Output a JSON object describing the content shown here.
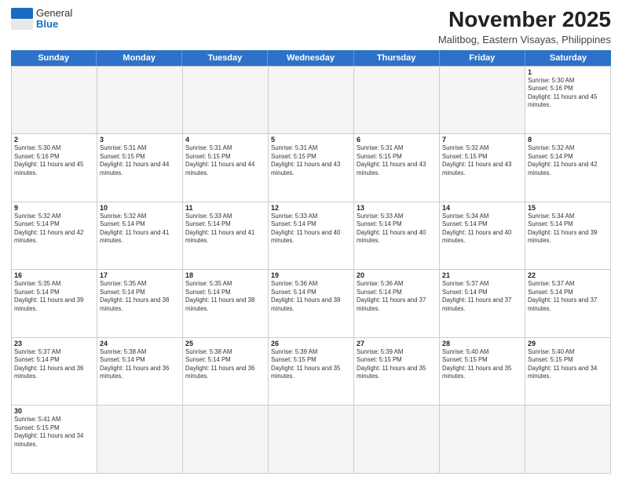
{
  "logo": {
    "general": "General",
    "blue": "Blue"
  },
  "header": {
    "month_year": "November 2025",
    "location": "Malitbog, Eastern Visayas, Philippines"
  },
  "weekdays": [
    "Sunday",
    "Monday",
    "Tuesday",
    "Wednesday",
    "Thursday",
    "Friday",
    "Saturday"
  ],
  "weeks": [
    [
      {
        "day": "",
        "empty": true
      },
      {
        "day": "",
        "empty": true
      },
      {
        "day": "",
        "empty": true
      },
      {
        "day": "",
        "empty": true
      },
      {
        "day": "",
        "empty": true
      },
      {
        "day": "",
        "empty": true
      },
      {
        "day": "1",
        "sunrise": "5:30 AM",
        "sunset": "5:16 PM",
        "daylight": "11 hours and 45 minutes."
      }
    ],
    [
      {
        "day": "2",
        "sunrise": "5:30 AM",
        "sunset": "5:16 PM",
        "daylight": "11 hours and 45 minutes."
      },
      {
        "day": "3",
        "sunrise": "5:31 AM",
        "sunset": "5:15 PM",
        "daylight": "11 hours and 44 minutes."
      },
      {
        "day": "4",
        "sunrise": "5:31 AM",
        "sunset": "5:15 PM",
        "daylight": "11 hours and 44 minutes."
      },
      {
        "day": "5",
        "sunrise": "5:31 AM",
        "sunset": "5:15 PM",
        "daylight": "11 hours and 43 minutes."
      },
      {
        "day": "6",
        "sunrise": "5:31 AM",
        "sunset": "5:15 PM",
        "daylight": "11 hours and 43 minutes."
      },
      {
        "day": "7",
        "sunrise": "5:32 AM",
        "sunset": "5:15 PM",
        "daylight": "11 hours and 43 minutes."
      },
      {
        "day": "8",
        "sunrise": "5:32 AM",
        "sunset": "5:14 PM",
        "daylight": "11 hours and 42 minutes."
      }
    ],
    [
      {
        "day": "9",
        "sunrise": "5:32 AM",
        "sunset": "5:14 PM",
        "daylight": "11 hours and 42 minutes."
      },
      {
        "day": "10",
        "sunrise": "5:32 AM",
        "sunset": "5:14 PM",
        "daylight": "11 hours and 41 minutes."
      },
      {
        "day": "11",
        "sunrise": "5:33 AM",
        "sunset": "5:14 PM",
        "daylight": "11 hours and 41 minutes."
      },
      {
        "day": "12",
        "sunrise": "5:33 AM",
        "sunset": "5:14 PM",
        "daylight": "11 hours and 40 minutes."
      },
      {
        "day": "13",
        "sunrise": "5:33 AM",
        "sunset": "5:14 PM",
        "daylight": "11 hours and 40 minutes."
      },
      {
        "day": "14",
        "sunrise": "5:34 AM",
        "sunset": "5:14 PM",
        "daylight": "11 hours and 40 minutes."
      },
      {
        "day": "15",
        "sunrise": "5:34 AM",
        "sunset": "5:14 PM",
        "daylight": "11 hours and 39 minutes."
      }
    ],
    [
      {
        "day": "16",
        "sunrise": "5:35 AM",
        "sunset": "5:14 PM",
        "daylight": "11 hours and 39 minutes."
      },
      {
        "day": "17",
        "sunrise": "5:35 AM",
        "sunset": "5:14 PM",
        "daylight": "11 hours and 38 minutes."
      },
      {
        "day": "18",
        "sunrise": "5:35 AM",
        "sunset": "5:14 PM",
        "daylight": "11 hours and 38 minutes."
      },
      {
        "day": "19",
        "sunrise": "5:36 AM",
        "sunset": "5:14 PM",
        "daylight": "11 hours and 38 minutes."
      },
      {
        "day": "20",
        "sunrise": "5:36 AM",
        "sunset": "5:14 PM",
        "daylight": "11 hours and 37 minutes."
      },
      {
        "day": "21",
        "sunrise": "5:37 AM",
        "sunset": "5:14 PM",
        "daylight": "11 hours and 37 minutes."
      },
      {
        "day": "22",
        "sunrise": "5:37 AM",
        "sunset": "5:14 PM",
        "daylight": "11 hours and 37 minutes."
      }
    ],
    [
      {
        "day": "23",
        "sunrise": "5:37 AM",
        "sunset": "5:14 PM",
        "daylight": "11 hours and 36 minutes."
      },
      {
        "day": "24",
        "sunrise": "5:38 AM",
        "sunset": "5:14 PM",
        "daylight": "11 hours and 36 minutes."
      },
      {
        "day": "25",
        "sunrise": "5:38 AM",
        "sunset": "5:14 PM",
        "daylight": "11 hours and 36 minutes."
      },
      {
        "day": "26",
        "sunrise": "5:39 AM",
        "sunset": "5:15 PM",
        "daylight": "11 hours and 35 minutes."
      },
      {
        "day": "27",
        "sunrise": "5:39 AM",
        "sunset": "5:15 PM",
        "daylight": "11 hours and 35 minutes."
      },
      {
        "day": "28",
        "sunrise": "5:40 AM",
        "sunset": "5:15 PM",
        "daylight": "11 hours and 35 minutes."
      },
      {
        "day": "29",
        "sunrise": "5:40 AM",
        "sunset": "5:15 PM",
        "daylight": "11 hours and 34 minutes."
      }
    ],
    [
      {
        "day": "30",
        "sunrise": "5:41 AM",
        "sunset": "5:15 PM",
        "daylight": "11 hours and 34 minutes."
      },
      {
        "day": "",
        "empty": true
      },
      {
        "day": "",
        "empty": true
      },
      {
        "day": "",
        "empty": true
      },
      {
        "day": "",
        "empty": true
      },
      {
        "day": "",
        "empty": true
      },
      {
        "day": "",
        "empty": true
      }
    ]
  ]
}
